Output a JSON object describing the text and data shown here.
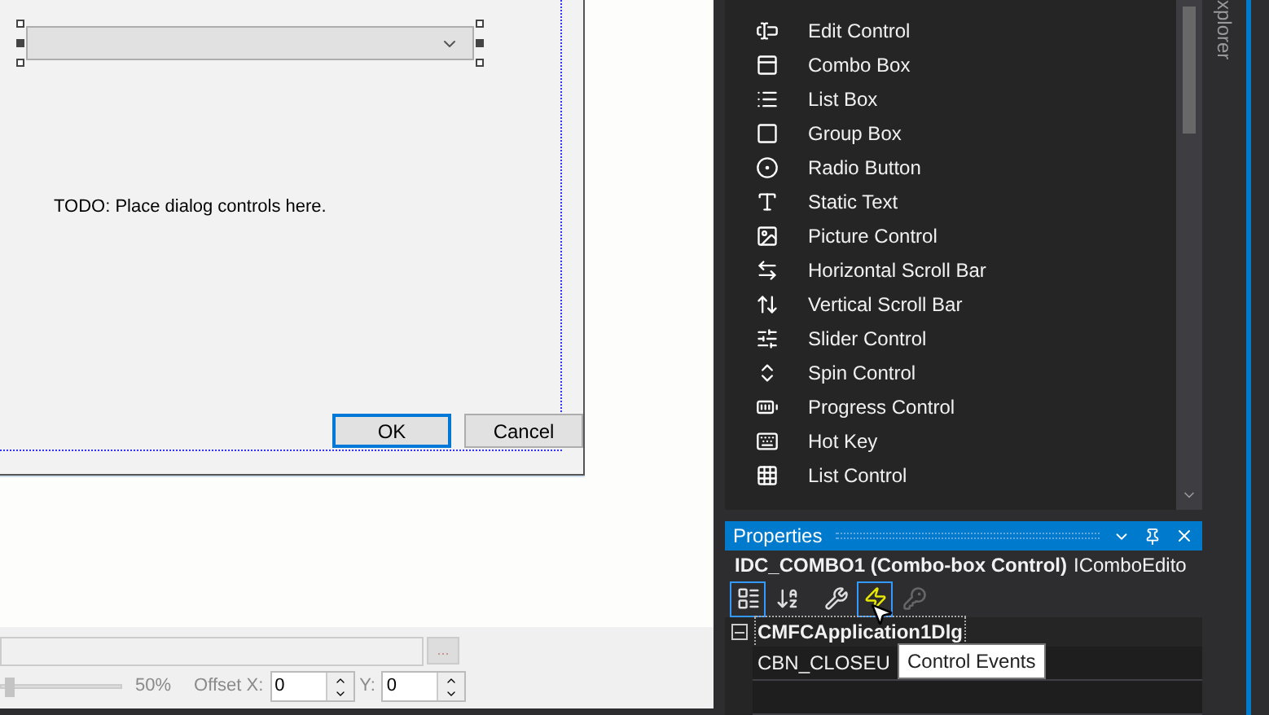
{
  "dialog": {
    "note": "TODO: Place dialog controls here.",
    "buttons": [
      {
        "label": "OK",
        "selected": true
      },
      {
        "label": "Cancel",
        "selected": false
      }
    ]
  },
  "bottom_bar": {
    "browse_button": "...",
    "zoom": {
      "level": 0.05,
      "reading": "50%"
    },
    "offset_x": {
      "label": "Offset X:",
      "value": "0"
    },
    "offset_y": {
      "label": "Y:",
      "value": "0"
    }
  },
  "toolbox": {
    "items": [
      {
        "label": "Edit Control"
      },
      {
        "label": "Combo Box"
      },
      {
        "label": "List Box"
      },
      {
        "label": "Group Box"
      },
      {
        "label": "Radio Button"
      },
      {
        "label": "Static Text"
      },
      {
        "label": "Picture Control"
      },
      {
        "label": "Horizontal Scroll Bar"
      },
      {
        "label": "Vertical Scroll Bar"
      },
      {
        "label": "Slider Control"
      },
      {
        "label": "Spin Control"
      },
      {
        "label": "Progress Control"
      },
      {
        "label": "Hot Key"
      },
      {
        "label": "List Control"
      }
    ]
  },
  "side_tab": "xplorer",
  "properties": {
    "title": "Properties",
    "object": "IDC_COMBO1 (Combo-box Control)",
    "object_type": "IComboEdito",
    "toolbar": [
      {
        "selected": true,
        "disabled": false
      },
      {
        "selected": false,
        "disabled": false
      },
      {
        "selected": false,
        "disabled": false
      },
      {
        "selected": true,
        "disabled": false
      },
      {
        "selected": false,
        "disabled": true
      }
    ],
    "category": {
      "label": "CMFCApplication1Dlg",
      "expanded": true,
      "rows": [
        "CBN_CLOSEU"
      ]
    },
    "tooltip": "Control Events"
  }
}
